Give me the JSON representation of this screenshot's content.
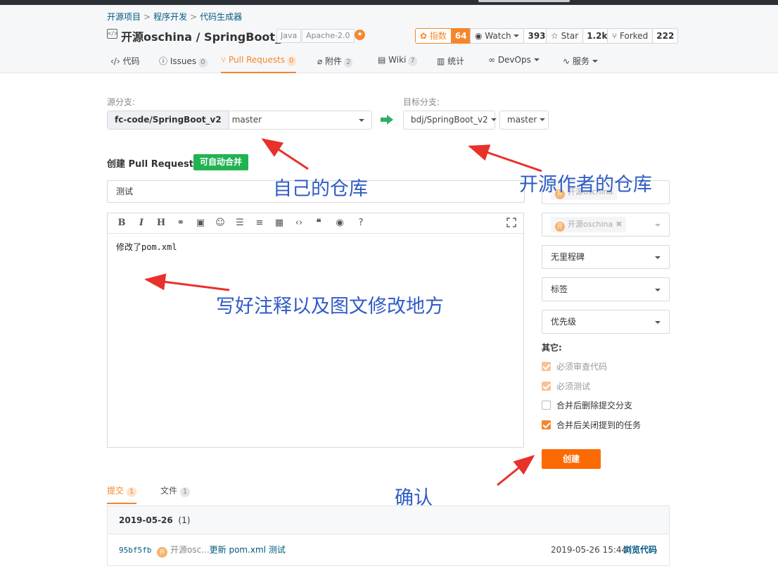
{
  "breadcrumb": {
    "items": [
      "开源项目",
      "程序开发",
      "代码生成器"
    ],
    "separator": ">"
  },
  "repo": {
    "title": "开源oschina / SpringBoot_v2",
    "tags": [
      "Java",
      "Apache-2.0"
    ],
    "icon": "code-repo-icon"
  },
  "stats": {
    "index": {
      "label": "指数",
      "count": "64"
    },
    "watch": {
      "label": "Watch",
      "count": "393"
    },
    "star": {
      "label": "Star",
      "count": "1.2k"
    },
    "forked": {
      "label": "Forked",
      "count": "222"
    }
  },
  "tabs": [
    {
      "label": "代码",
      "icon": "code-icon"
    },
    {
      "label": "Issues",
      "count": "0",
      "icon": "issue-icon"
    },
    {
      "label": "Pull Requests",
      "count": "0",
      "icon": "pull-request-icon",
      "active": true
    },
    {
      "label": "附件",
      "count": "2",
      "icon": "attachment-icon"
    },
    {
      "label": "Wiki",
      "count": "7",
      "icon": "wiki-icon"
    },
    {
      "label": "统计",
      "icon": "chart-icon"
    },
    {
      "label": "DevOps",
      "icon": "infinity-icon"
    },
    {
      "label": "服务",
      "icon": "pulse-icon"
    }
  ],
  "source": {
    "label": "源分支:",
    "repo": "fc-code/SpringBoot_v2",
    "branch": "master"
  },
  "target": {
    "label": "目标分支:",
    "repo": "bdj/SpringBoot_v2",
    "branch": "master"
  },
  "create": {
    "title": "创建 Pull Request",
    "auto_merge": "可自动合并",
    "pr_title_value": "测试",
    "body_value": "修改了pom.xml",
    "submit": "创建"
  },
  "sidebar": {
    "reviewer_chip": "开源oschina",
    "tester_chip": "开源oschina",
    "milestone": "无里程碑",
    "labels": "标签",
    "priority": "优先级",
    "other_title": "其它:",
    "options": [
      {
        "label": "必须审查代码",
        "checked": true,
        "disabled": true
      },
      {
        "label": "必须测试",
        "checked": true,
        "disabled": true
      },
      {
        "label": "合并后删除提交分支",
        "checked": false,
        "disabled": false
      },
      {
        "label": "合并后关闭提到的任务",
        "checked": true,
        "disabled": false
      }
    ]
  },
  "bottom_tabs": [
    {
      "label": "提交",
      "count": "1",
      "active": true
    },
    {
      "label": "文件",
      "count": "1"
    }
  ],
  "commits": {
    "date": "2019-05-26",
    "date_count": "(1)",
    "items": [
      {
        "hash": "95bf5fb",
        "avatar": "开",
        "author": "开源osc...",
        "message": "更新 pom.xml 测试",
        "time": "2019-05-26 15:44",
        "action": "浏览代码"
      }
    ]
  },
  "annotations": {
    "own_repo": "自己的仓库",
    "author_repo": "开源作者的仓库",
    "notes": "写好注释以及图文修改地方",
    "confirm": "确认"
  },
  "colors": {
    "accent": "#f5862a",
    "button": "#fc6a04",
    "merge_green": "#21b351",
    "link": "#005980",
    "annotation": "#2f5bc6",
    "arrow": "#e8312a"
  }
}
